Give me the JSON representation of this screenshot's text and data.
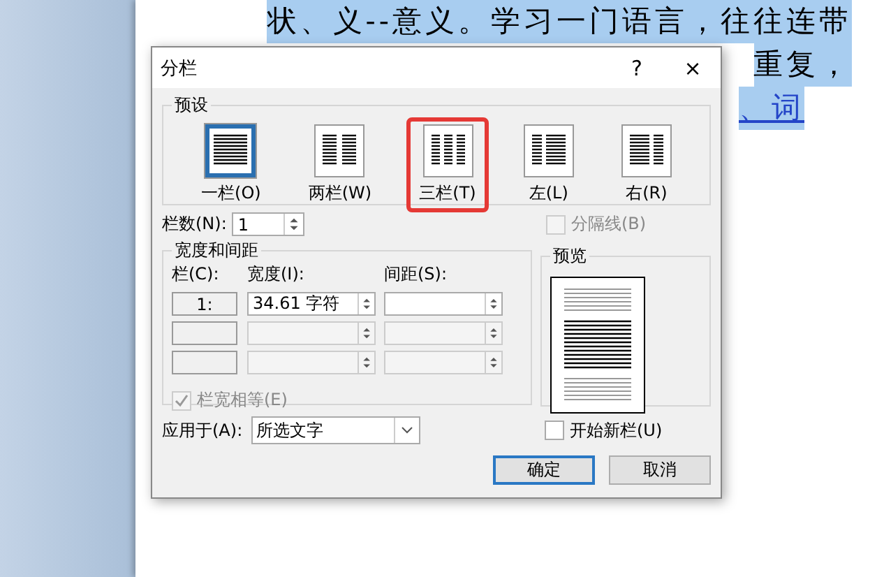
{
  "document": {
    "lines": [
      {
        "text": "状、义--意义。学习一门语言，往往连带",
        "link": false
      },
      {
        "text": "重复，",
        "link": false
      },
      {
        "text": "、词",
        "link": true
      }
    ]
  },
  "dialog": {
    "title": "分栏",
    "help": "?",
    "close": "×",
    "presets": {
      "label": "预设",
      "items": [
        {
          "label": "一栏(O)",
          "kind": "one",
          "selected": true,
          "highlighted": false
        },
        {
          "label": "两栏(W)",
          "kind": "two",
          "selected": false,
          "highlighted": false
        },
        {
          "label": "三栏(T)",
          "kind": "three",
          "selected": false,
          "highlighted": true
        },
        {
          "label": "左(L)",
          "kind": "left",
          "selected": false,
          "highlighted": false
        },
        {
          "label": "右(R)",
          "kind": "right",
          "selected": false,
          "highlighted": false
        }
      ]
    },
    "count": {
      "label": "栏数(N):",
      "value": "1"
    },
    "separator": {
      "label": "分隔线(B)",
      "checked": false,
      "disabled": true
    },
    "widths": {
      "label": "宽度和间距",
      "headers": [
        "栏(C):",
        "宽度(I):",
        "间距(S):"
      ],
      "rows": [
        {
          "column": "1:",
          "width": "34.61 字符",
          "spacing": "",
          "disabled": false
        },
        {
          "column": "",
          "width": "",
          "spacing": "",
          "disabled": true
        },
        {
          "column": "",
          "width": "",
          "spacing": "",
          "disabled": true
        }
      ],
      "equal": {
        "label": "栏宽相等(E)",
        "checked": true,
        "disabled": true
      }
    },
    "preview": {
      "label": "预览"
    },
    "apply": {
      "label": "应用于(A):",
      "value": "所选文字"
    },
    "new_column": {
      "label": "开始新栏(U)",
      "checked": false,
      "disabled": false
    },
    "buttons": [
      {
        "label": "确定",
        "default": true
      },
      {
        "label": "取消",
        "default": false
      }
    ]
  }
}
